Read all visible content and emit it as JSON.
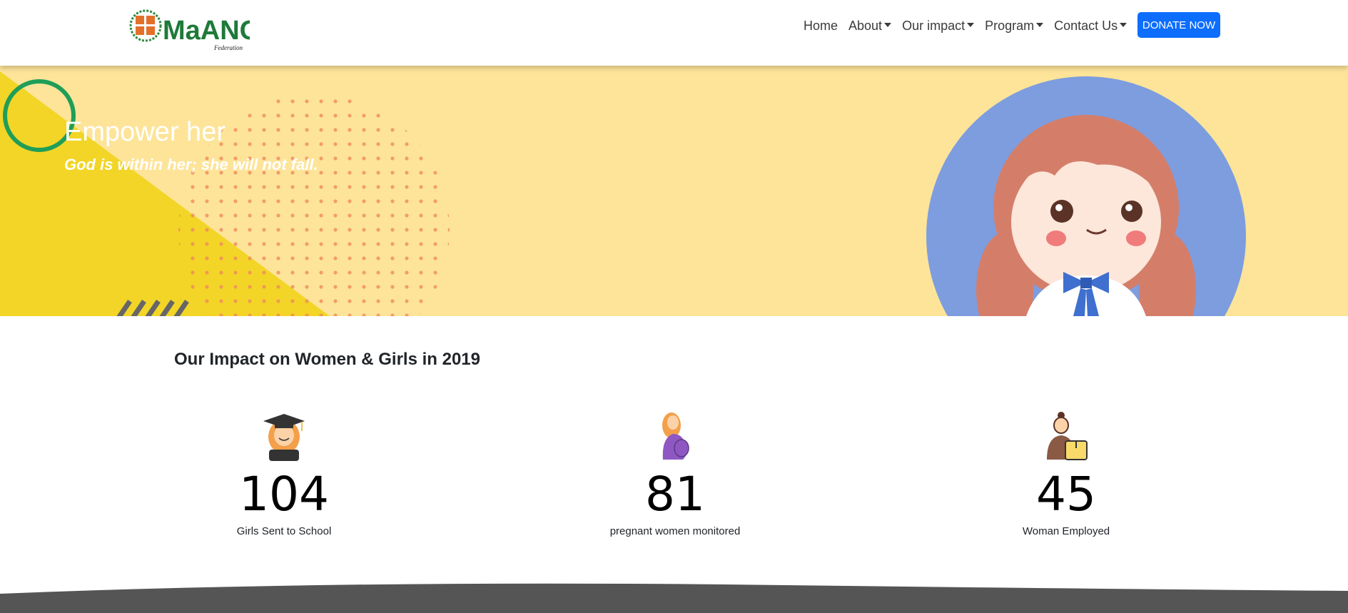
{
  "navbar": {
    "logo_text": "MaANOF",
    "logo_subtext": "Federation",
    "links": [
      {
        "label": "Home",
        "dropdown": false
      },
      {
        "label": "About",
        "dropdown": true
      },
      {
        "label": "Our impact",
        "dropdown": true
      },
      {
        "label": "Program",
        "dropdown": true
      },
      {
        "label": "Contact Us",
        "dropdown": true
      }
    ],
    "donate_label": "DONATE NOW"
  },
  "hero": {
    "title": "Empower her",
    "subtitle": "God is within her; she will not fall."
  },
  "impact": {
    "title": "Our Impact on Women & Girls in 2019",
    "stats": [
      {
        "icon": "graduate-girl-icon",
        "number": "104",
        "label": "Girls Sent to School"
      },
      {
        "icon": "pregnant-woman-icon",
        "number": "81",
        "label": "pregnant women monitored"
      },
      {
        "icon": "working-woman-icon",
        "number": "45",
        "label": "Woman Employed"
      }
    ]
  },
  "colors": {
    "donate_button": "#0d6efd",
    "hero_background": "#fde499",
    "hero_triangle": "#f2d526",
    "hero_circle_ring": "#1f9e58",
    "hero_dots": "#f08a5d",
    "girl_circle": "#7d9ddf",
    "footer_wave": "#555555"
  }
}
